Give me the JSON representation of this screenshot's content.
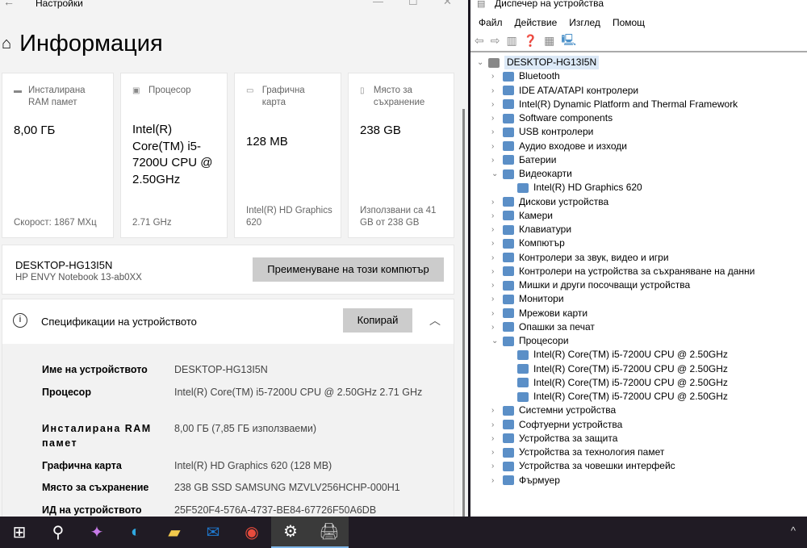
{
  "settings": {
    "window_title": "Настройки",
    "page_title": "Информация",
    "cards": [
      {
        "label": "Инсталирана RAM памет",
        "value": "8,00 ГБ",
        "footer": "Скорост: 1867 МХц"
      },
      {
        "label": "Процесор",
        "value": "Intel(R) Core(TM) i5-7200U CPU @ 2.50GHz",
        "footer": "2.71 GHz"
      },
      {
        "label": "Графична карта",
        "value": "128 MB",
        "footer": "Intel(R) HD Graphics 620"
      },
      {
        "label": "Място за съхранение",
        "value": "238 GB",
        "footer": "Използвани са 41 GB от 238 GB"
      }
    ],
    "pc_name": "DESKTOP-HG13I5N",
    "pc_model": "HP ENVY Notebook 13-ab0XX",
    "rename_button": "Преименуване на този компютър",
    "specs_title": "Спецификации на устройството",
    "copy_button": "Копирай",
    "specs": [
      {
        "k": "Име на устройството",
        "v": "DESKTOP-HG13I5N"
      },
      {
        "k": "Процесор",
        "v": "Intel(R) Core(TM) i5-7200U CPU @ 2.50GHz   2.71 GHz"
      },
      {
        "k": "Инсталирана RAM памет",
        "v": "8,00 ГБ (7,85 ГБ използваеми)"
      },
      {
        "k": "Графична карта",
        "v": "Intel(R) HD Graphics 620 (128 MB)"
      },
      {
        "k": "Място за съхранение",
        "v": "238 GB SSD SAMSUNG MZVLV256HCHP-000H1"
      },
      {
        "k": "ИД на устройството",
        "v": "25F520F4-576A-4737-BE84-67726F50A6DB"
      }
    ]
  },
  "devmgr": {
    "title": "Диспечер на устройства",
    "menu": [
      "Файл",
      "Действие",
      "Изглед",
      "Помощ"
    ],
    "tree": [
      {
        "label": "DESKTOP-HG13I5N",
        "level": 0,
        "state": "open"
      },
      {
        "label": "Bluetooth",
        "level": 1,
        "state": "closed"
      },
      {
        "label": "IDE ATA/ATAPI контролери",
        "level": 1,
        "state": "closed"
      },
      {
        "label": "Intel(R) Dynamic Platform and Thermal Framework",
        "level": 1,
        "state": "closed"
      },
      {
        "label": "Software components",
        "level": 1,
        "state": "closed"
      },
      {
        "label": "USB контролери",
        "level": 1,
        "state": "closed"
      },
      {
        "label": "Аудио входове и изходи",
        "level": 1,
        "state": "closed"
      },
      {
        "label": "Батерии",
        "level": 1,
        "state": "closed"
      },
      {
        "label": "Видеокарти",
        "level": 1,
        "state": "open"
      },
      {
        "label": "Intel(R) HD Graphics 620",
        "level": 2,
        "state": "leaf"
      },
      {
        "label": "Дискови устройства",
        "level": 1,
        "state": "closed"
      },
      {
        "label": "Камери",
        "level": 1,
        "state": "closed"
      },
      {
        "label": "Клавиатури",
        "level": 1,
        "state": "closed"
      },
      {
        "label": "Компютър",
        "level": 1,
        "state": "closed"
      },
      {
        "label": "Контролери за звук, видео и игри",
        "level": 1,
        "state": "closed"
      },
      {
        "label": "Контролери на устройства за съхраняване на данни",
        "level": 1,
        "state": "closed"
      },
      {
        "label": "Мишки и други посочващи устройства",
        "level": 1,
        "state": "closed"
      },
      {
        "label": "Монитори",
        "level": 1,
        "state": "closed"
      },
      {
        "label": "Мрежови карти",
        "level": 1,
        "state": "closed"
      },
      {
        "label": "Опашки за печат",
        "level": 1,
        "state": "closed"
      },
      {
        "label": "Процесори",
        "level": 1,
        "state": "open"
      },
      {
        "label": "Intel(R) Core(TM) i5-7200U CPU @ 2.50GHz",
        "level": 2,
        "state": "leaf"
      },
      {
        "label": "Intel(R) Core(TM) i5-7200U CPU @ 2.50GHz",
        "level": 2,
        "state": "leaf"
      },
      {
        "label": "Intel(R) Core(TM) i5-7200U CPU @ 2.50GHz",
        "level": 2,
        "state": "leaf"
      },
      {
        "label": "Intel(R) Core(TM) i5-7200U CPU @ 2.50GHz",
        "level": 2,
        "state": "leaf"
      },
      {
        "label": "Системни устройства",
        "level": 1,
        "state": "closed"
      },
      {
        "label": "Софтуерни устройства",
        "level": 1,
        "state": "closed"
      },
      {
        "label": "Устройства за защита",
        "level": 1,
        "state": "closed"
      },
      {
        "label": "Устройства за технология памет",
        "level": 1,
        "state": "closed"
      },
      {
        "label": "Устройства за човешки интерфейс",
        "level": 1,
        "state": "closed"
      },
      {
        "label": "Фърмуер",
        "level": 1,
        "state": "closed"
      }
    ]
  },
  "taskbar": {
    "icons": [
      "start",
      "search",
      "copilot",
      "edge",
      "file-explorer",
      "outlook",
      "chrome",
      "settings",
      "device-manager"
    ]
  }
}
